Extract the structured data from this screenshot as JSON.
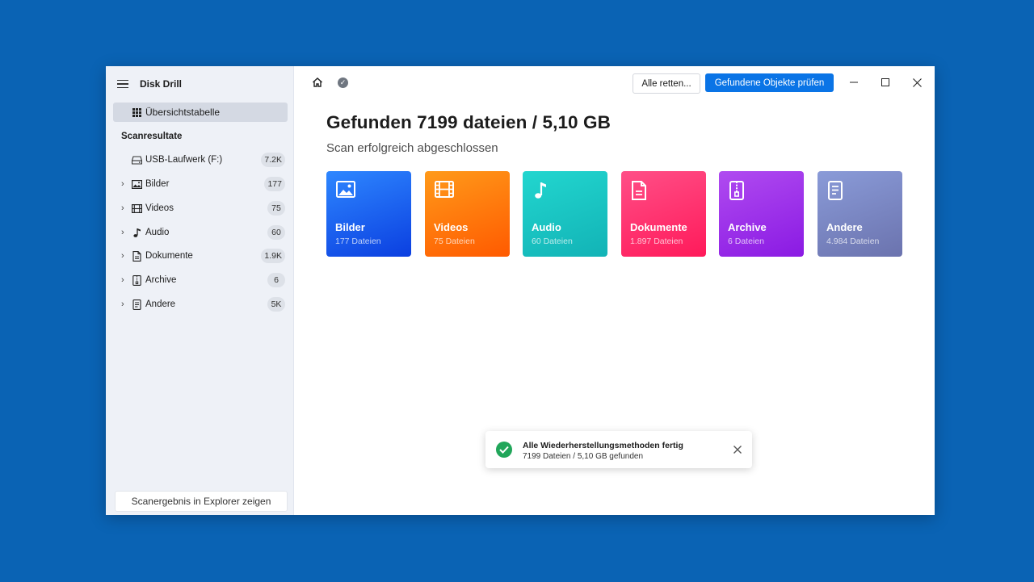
{
  "app": {
    "title": "Disk Drill"
  },
  "sidebar": {
    "overview_label": "Übersichtstabelle",
    "section_title": "Scanresultate",
    "items": [
      {
        "label": "USB-Laufwerk (F:)",
        "badge": "7.2K",
        "icon": "usb-drive-icon"
      },
      {
        "label": "Bilder",
        "badge": "177",
        "icon": "image-icon"
      },
      {
        "label": "Videos",
        "badge": "75",
        "icon": "film-icon"
      },
      {
        "label": "Audio",
        "badge": "60",
        "icon": "music-note-icon"
      },
      {
        "label": "Dokumente",
        "badge": "1.9K",
        "icon": "document-icon"
      },
      {
        "label": "Archive",
        "badge": "6",
        "icon": "archive-icon"
      },
      {
        "label": "Andere",
        "badge": "5K",
        "icon": "file-icon"
      }
    ],
    "bottom_button": "Scanergebnis in Explorer zeigen"
  },
  "toolbar": {
    "recover_all": "Alle retten...",
    "review_found": "Gefundene Objekte prüfen"
  },
  "main": {
    "title": "Gefunden 7199 dateien / 5,10 GB",
    "subtitle": "Scan erfolgreich abgeschlossen",
    "cards": [
      {
        "name": "Bilder",
        "count": "177 Dateien",
        "color_top": "#2e87ff",
        "color_bottom": "#0b3fe0",
        "icon": "image-icon"
      },
      {
        "name": "Videos",
        "count": "75 Dateien",
        "color_top": "#ff9a1a",
        "color_bottom": "#ff5a00",
        "icon": "film-icon"
      },
      {
        "name": "Audio",
        "count": "60 Dateien",
        "color_top": "#22d6cf",
        "color_bottom": "#12b3b6",
        "icon": "music-note-icon"
      },
      {
        "name": "Dokumente",
        "count": "1.897 Dateien",
        "color_top": "#ff4f87",
        "color_bottom": "#ff1a5a",
        "icon": "document-icon"
      },
      {
        "name": "Archive",
        "count": "6 Dateien",
        "color_top": "#b04bf0",
        "color_bottom": "#8a1ae3",
        "icon": "archive-icon"
      },
      {
        "name": "Andere",
        "count": "4.984 Dateien",
        "color_top": "#8a9bd8",
        "color_bottom": "#6b73ae",
        "icon": "file-icon"
      }
    ]
  },
  "toast": {
    "title": "Alle Wiederherstellungsmethoden fertig",
    "subtitle": "7199 Dateien / 5,10 GB gefunden"
  },
  "colors": {
    "desktop_bg": "#0a63b4",
    "primary_button": "#0a74e6",
    "success": "#21a65a"
  }
}
